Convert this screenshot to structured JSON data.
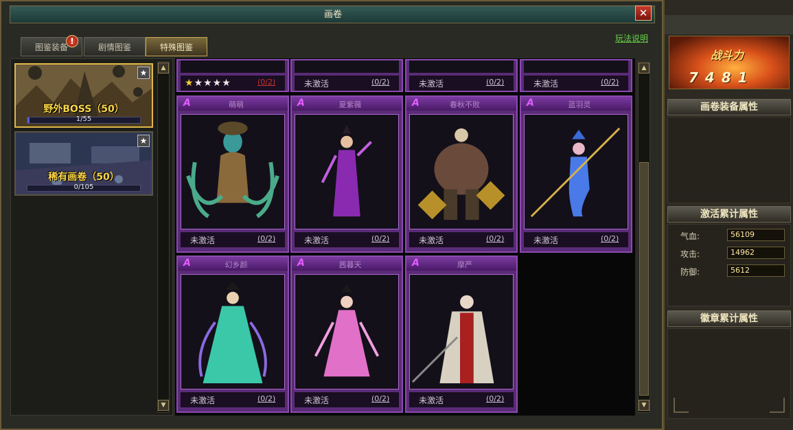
{
  "window": {
    "title": "画卷",
    "close": "✕"
  },
  "tabs": [
    {
      "label": "图鉴装备",
      "active": false,
      "badge": "!"
    },
    {
      "label": "剧情图鉴",
      "active": false
    },
    {
      "label": "特殊图鉴",
      "active": true
    }
  ],
  "help_link": "玩法说明",
  "albums": [
    {
      "name": "野外BOSS（50）",
      "progress": "1/55",
      "progress_fraction": 0.018,
      "selected": true,
      "star": "★"
    },
    {
      "name": "稀有画卷（50）",
      "progress": "0/105",
      "progress_fraction": 0.0,
      "selected": false,
      "star": "★"
    }
  ],
  "top_row": [
    {
      "status": "",
      "progress": "(0/2)",
      "stars_on": 1,
      "stars_total": 5,
      "progress_color": "#d23030"
    },
    {
      "status": "未激活",
      "progress": "(0/2)"
    },
    {
      "status": "未激活",
      "progress": "(0/2)"
    },
    {
      "status": "未激活",
      "progress": "(0/2)"
    }
  ],
  "cards": [
    {
      "glyph": "A",
      "name": "萌萌",
      "status": "未激活",
      "progress": "(0/2)",
      "icon": "medusa-monster-figure"
    },
    {
      "glyph": "A",
      "name": "夏紫薇",
      "status": "未激活",
      "progress": "(0/2)",
      "icon": "purple-lady-figure"
    },
    {
      "glyph": "A",
      "name": "春秋不败",
      "status": "未激活",
      "progress": "(0/2)",
      "icon": "armored-brute-figure"
    },
    {
      "glyph": "A",
      "name": "蓝羽灵",
      "status": "未激活",
      "progress": "(0/2)",
      "icon": "mermaid-trident-figure"
    },
    {
      "glyph": "A",
      "name": "幻乡颜",
      "status": "未激活",
      "progress": "(0/2)",
      "icon": "jade-maiden-figure"
    },
    {
      "glyph": "A",
      "name": "茜暮天",
      "status": "未激活",
      "progress": "(0/2)",
      "icon": "pink-dancer-figure"
    },
    {
      "glyph": "A",
      "name": "摩严",
      "status": "未激活",
      "progress": "(0/2)",
      "icon": "elder-sage-figure"
    }
  ],
  "side": {
    "power_label": "战斗力",
    "power_value": "7481",
    "equip_attr_title": "画卷装备属性",
    "accum_attr_title": "激活累计属性",
    "stats": [
      {
        "label": "气血:",
        "value": "56109"
      },
      {
        "label": "攻击:",
        "value": "14962"
      },
      {
        "label": "防御:",
        "value": "5612"
      }
    ],
    "badge_attr_title": "徽章累计属性"
  },
  "colors": {
    "card_purple": "#5a2c78",
    "gold": "#ffd84a",
    "link_green": "#66d24a"
  }
}
